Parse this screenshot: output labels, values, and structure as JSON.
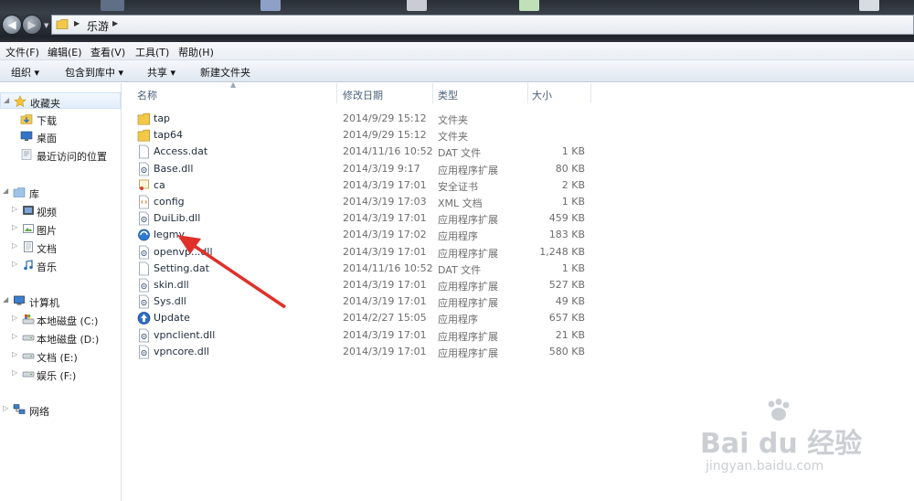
{
  "address": {
    "segments": [
      "乐游"
    ]
  },
  "menubar": [
    "文件(F)",
    "编辑(E)",
    "查看(V)",
    "工具(T)",
    "帮助(H)"
  ],
  "commands": {
    "organize": "组织 ▾",
    "include_library": "包含到库中 ▾",
    "share": "共享 ▾",
    "new_folder": "新建文件夹"
  },
  "nav": {
    "favorites": "收藏夹",
    "downloads": "下载",
    "desktop": "桌面",
    "recent": "最近访问的位置",
    "libraries": "库",
    "videos": "视频",
    "pictures": "图片",
    "documents": "文档",
    "music": "音乐",
    "computer": "计算机",
    "drive_c": "本地磁盘 (C:)",
    "drive_d": "本地磁盘 (D:)",
    "drive_e": "文档 (E:)",
    "drive_f": "娱乐 (F:)",
    "network": "网络"
  },
  "columns": {
    "name": "名称",
    "modified": "修改日期",
    "type": "类型",
    "size": "大小"
  },
  "files": [
    {
      "name": "tap",
      "date": "2014/9/29 15:12",
      "type": "文件夹",
      "size": "",
      "icon": "folder-icon"
    },
    {
      "name": "tap64",
      "date": "2014/9/29 15:12",
      "type": "文件夹",
      "size": "",
      "icon": "folder-icon"
    },
    {
      "name": "Access.dat",
      "date": "2014/11/16 10:52",
      "type": "DAT 文件",
      "size": "1 KB",
      "icon": "file-icon"
    },
    {
      "name": "Base.dll",
      "date": "2014/3/19 9:17",
      "type": "应用程序扩展",
      "size": "80 KB",
      "icon": "dll-icon"
    },
    {
      "name": "ca",
      "date": "2014/3/19 17:01",
      "type": "安全证书",
      "size": "2 KB",
      "icon": "certificate-icon"
    },
    {
      "name": "config",
      "date": "2014/3/19 17:03",
      "type": "XML 文档",
      "size": "1 KB",
      "icon": "xml-icon"
    },
    {
      "name": "DuiLib.dll",
      "date": "2014/3/19 17:01",
      "type": "应用程序扩展",
      "size": "459 KB",
      "icon": "dll-icon"
    },
    {
      "name": "legmy",
      "date": "2014/3/19 17:02",
      "type": "应用程序",
      "size": "183 KB",
      "icon": "app-icon"
    },
    {
      "name": "openvp...dll",
      "date": "2014/3/19 17:01",
      "type": "应用程序扩展",
      "size": "1,248 KB",
      "icon": "dll-icon"
    },
    {
      "name": "Setting.dat",
      "date": "2014/11/16 10:52",
      "type": "DAT 文件",
      "size": "1 KB",
      "icon": "file-icon"
    },
    {
      "name": "skin.dll",
      "date": "2014/3/19 17:01",
      "type": "应用程序扩展",
      "size": "527 KB",
      "icon": "dll-icon"
    },
    {
      "name": "Sys.dll",
      "date": "2014/3/19 17:01",
      "type": "应用程序扩展",
      "size": "49 KB",
      "icon": "dll-icon"
    },
    {
      "name": "Update",
      "date": "2014/2/27 15:05",
      "type": "应用程序",
      "size": "657 KB",
      "icon": "update-icon"
    },
    {
      "name": "vpnclient.dll",
      "date": "2014/3/19 17:01",
      "type": "应用程序扩展",
      "size": "21 KB",
      "icon": "dll-icon"
    },
    {
      "name": "vpncore.dll",
      "date": "2014/3/19 17:01",
      "type": "应用程序扩展",
      "size": "580 KB",
      "icon": "dll-icon"
    }
  ],
  "watermark": {
    "main": "Bai du 经验",
    "sub": "jingyan.baidu.com"
  },
  "colors": {
    "arrow": "#e0302a",
    "folder": "#f2c84b",
    "accent": "#4c607a"
  }
}
